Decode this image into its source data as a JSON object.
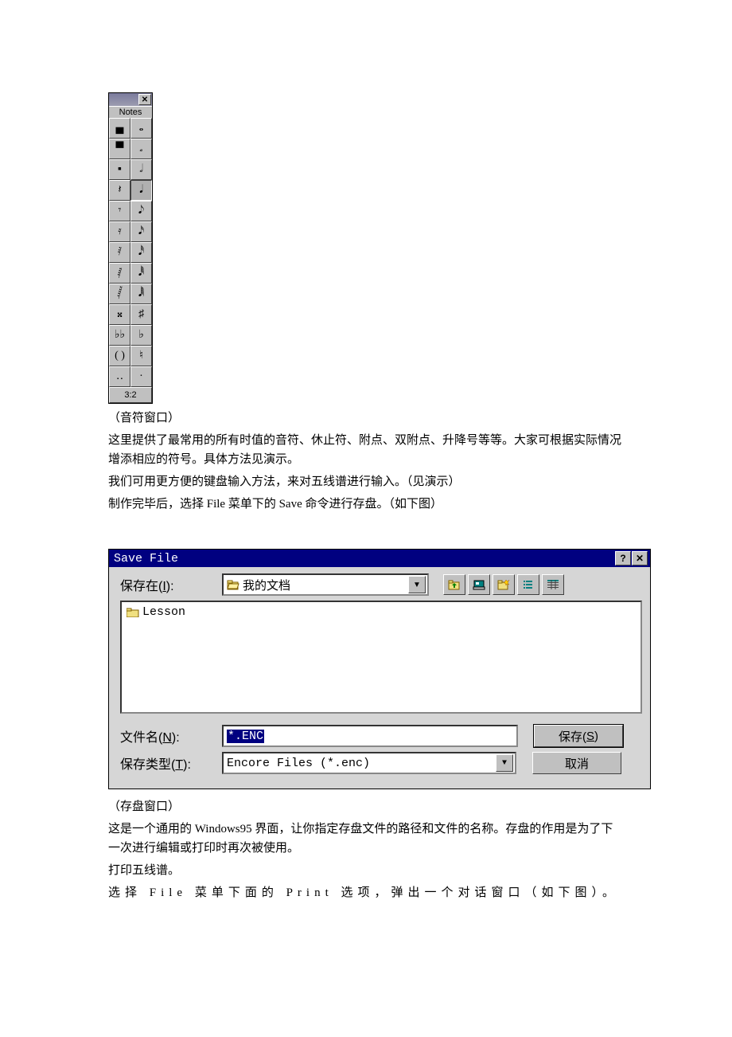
{
  "notes_palette": {
    "title": "Notes",
    "tuplet": "3:2",
    "cells": [
      {
        "name": "whole-rest",
        "glyph": "▄"
      },
      {
        "name": "whole-note",
        "glyph": "𝅝"
      },
      {
        "name": "half-rest",
        "glyph": "▀"
      },
      {
        "name": "half-note-open",
        "glyph": "𝅗"
      },
      {
        "name": "half-rest-2",
        "glyph": "▪"
      },
      {
        "name": "half-note",
        "glyph": "𝅗𝅥"
      },
      {
        "name": "quarter-rest",
        "glyph": "𝄽"
      },
      {
        "name": "quarter-note",
        "glyph": "𝅘𝅥",
        "active": true
      },
      {
        "name": "eighth-rest",
        "glyph": "𝄾"
      },
      {
        "name": "eighth-note",
        "glyph": "𝅘𝅥𝅮"
      },
      {
        "name": "sixteenth-rest",
        "glyph": "𝄿"
      },
      {
        "name": "sixteenth-note",
        "glyph": "𝅘𝅥𝅯"
      },
      {
        "name": "thirtysecond-rest",
        "glyph": "𝅀"
      },
      {
        "name": "thirtysecond-note",
        "glyph": "𝅘𝅥𝅰"
      },
      {
        "name": "sixtyfourth-rest",
        "glyph": "𝅁"
      },
      {
        "name": "sixtyfourth-note",
        "glyph": "𝅘𝅥𝅱"
      },
      {
        "name": "onetwentyeighth-rest",
        "glyph": "𝅂"
      },
      {
        "name": "onetwentyeighth-note",
        "glyph": "𝅘𝅥𝅲"
      },
      {
        "name": "double-sharp",
        "glyph": "𝄪"
      },
      {
        "name": "sharp",
        "glyph": "♯"
      },
      {
        "name": "double-flat",
        "glyph": "♭♭"
      },
      {
        "name": "flat",
        "glyph": "♭"
      },
      {
        "name": "parentheses",
        "glyph": "( )"
      },
      {
        "name": "natural",
        "glyph": "♮"
      },
      {
        "name": "double-dot",
        "glyph": "‥"
      },
      {
        "name": "dot",
        "glyph": "·"
      }
    ]
  },
  "doc": {
    "caption1": "（音符窗口）",
    "para1": "这里提供了最常用的所有时值的音符、休止符、附点、双附点、升降号等等。大家可根据实际情况增添相应的符号。具体方法见演示。",
    "para2": "我们可用更方便的键盘输入方法，来对五线谱进行输入。（见演示）",
    "para3": "制作完毕后，选择 File 菜单下的 Save 命令进行存盘。（如下图）",
    "caption2": "（存盘窗口）",
    "para4": "这是一个通用的 Windows95 界面，让你指定存盘文件的路径和文件的名称。存盘的作用是为了下一次进行编辑或打印时再次被使用。",
    "para5": "打印五线谱。",
    "para6": "选择 File 菜单下面的 Print 选项，弹出一个对话窗口（如下图）。"
  },
  "save_dialog": {
    "title": "Save File",
    "save_in_label_pre": "保存在(",
    "save_in_key": "I",
    "save_in_label_post": "):",
    "location": "我的文档",
    "folder_item": "Lesson",
    "filename_label_pre": "文件名(",
    "filename_key": "N",
    "filename_label_post": "):",
    "filename_value": "*.ENC",
    "filetype_label_pre": "保存类型(",
    "filetype_key": "T",
    "filetype_label_post": "):",
    "filetype_value": "Encore Files (*.enc)",
    "save_btn_pre": "保存(",
    "save_btn_key": "S",
    "save_btn_post": ")",
    "cancel_btn": "取消"
  }
}
